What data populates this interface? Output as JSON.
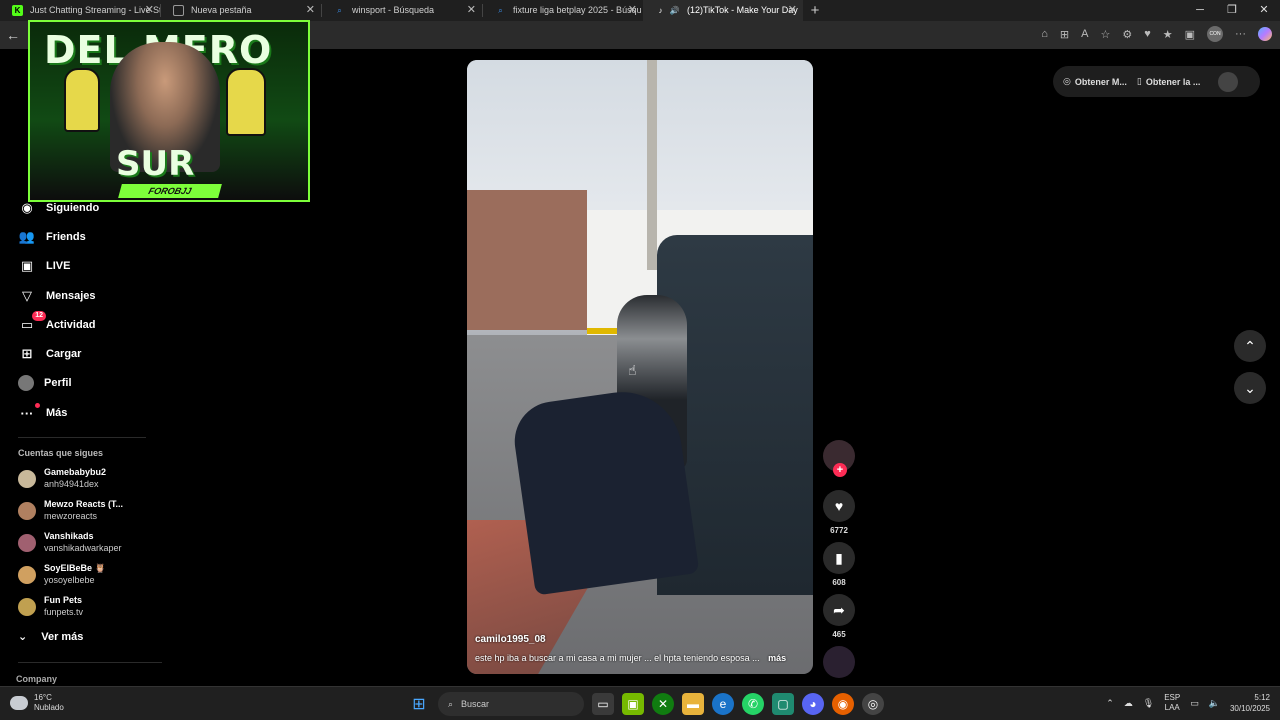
{
  "tabs": [
    {
      "title": "Just Chatting Streaming - Live Str",
      "icon": "kick-icon",
      "color": "#53fc18",
      "active": false
    },
    {
      "title": "Nueva pestaña",
      "icon": "page-icon",
      "color": "#888888",
      "active": false
    },
    {
      "title": "winsport - Búsqueda",
      "icon": "search-icon",
      "color": "#3b8eea",
      "active": false
    },
    {
      "title": "fixture liga betplay 2025 - Búsqu",
      "icon": "search-icon",
      "color": "#3b8eea",
      "active": false
    },
    {
      "title": "(12)TikTok - Make Your Day",
      "icon": "tiktok-icon",
      "color": "#ffffff",
      "active": true
    }
  ],
  "overlay": {
    "top_text": "DEL MERO",
    "bottom_text": "SUR",
    "label": "FOROBJJ"
  },
  "sidebar": {
    "items": [
      {
        "label": "Siguiendo",
        "icon": "following-icon"
      },
      {
        "label": "Friends",
        "icon": "friends-icon"
      },
      {
        "label": "LIVE",
        "icon": "live-icon"
      },
      {
        "label": "Mensajes",
        "icon": "messages-icon"
      },
      {
        "label": "Actividad",
        "icon": "activity-icon",
        "badge": "12"
      },
      {
        "label": "Cargar",
        "icon": "upload-icon"
      },
      {
        "label": "Perfil",
        "icon": "profile-icon"
      },
      {
        "label": "Más",
        "icon": "more-icon"
      }
    ],
    "following_title": "Cuentas que sigues",
    "accounts": [
      {
        "name": "Gamebabybu2",
        "username": "anh94941dex",
        "color": "#c8b89a"
      },
      {
        "name": "Mewzo Reacts (T...",
        "username": "mewzoreacts",
        "color": "#b08060"
      },
      {
        "name": "Vanshikads",
        "username": "vanshikadwarkaper",
        "color": "#a06070"
      },
      {
        "name": "SoyElBeBe 🦉",
        "username": "yosoyelbebe",
        "color": "#d0a060"
      },
      {
        "name": "Fun Pets",
        "username": "funpets.tv",
        "color": "#c0a050"
      }
    ],
    "see_more": "Ver más",
    "company": "Company"
  },
  "video": {
    "author": "camilo1995_08",
    "caption": "este hp iba a buscar a mi casa a mi mujer ... el hpta teniendo esposa ...",
    "more": "más"
  },
  "actions": {
    "likes": "6772",
    "saves": "608",
    "shares": "465"
  },
  "top_actions": {
    "get_app": "Obtener M...",
    "get_pc": "Obtener la ..."
  },
  "taskbar": {
    "temp": "16°C",
    "weather": "Nublado",
    "search": "Buscar",
    "lang1": "ESP",
    "lang2": "LAA",
    "time": "5:12",
    "date": "30/10/2025"
  }
}
